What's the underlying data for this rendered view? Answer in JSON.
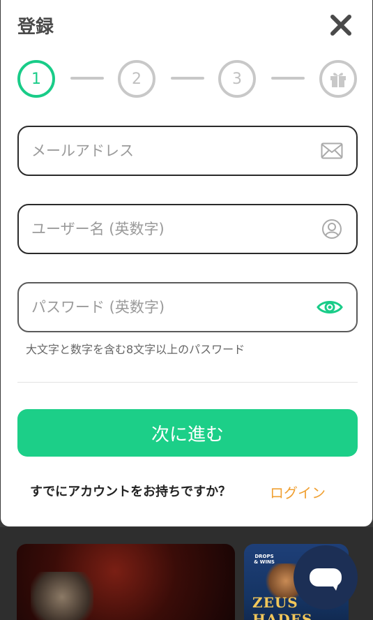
{
  "modal": {
    "title": "登録",
    "close_icon": "close-icon"
  },
  "stepper": {
    "steps": [
      "1",
      "2",
      "3"
    ],
    "gift_icon": "gift-icon",
    "active_step": 1
  },
  "form": {
    "email": {
      "placeholder": "メールアドレス",
      "value": "",
      "icon": "envelope-icon"
    },
    "username": {
      "placeholder": "ユーザー名 (英数字)",
      "value": "",
      "icon": "user-icon"
    },
    "password": {
      "placeholder": "パスワード (英数字)",
      "value": "",
      "icon": "eye-icon"
    },
    "password_hint": "大文字と数字を含む8文字以上のパスワード"
  },
  "actions": {
    "next_label": "次に進む",
    "already_text": "すでにアカウントをお持ちですか？",
    "login_label": "ログイン"
  },
  "background": {
    "promo_label": "DROPS & WINS",
    "game_logo": "ZEUS HADES"
  },
  "colors": {
    "accent": "#1ccf88",
    "link": "#f0a032",
    "chat_bg": "#1c2f55"
  }
}
